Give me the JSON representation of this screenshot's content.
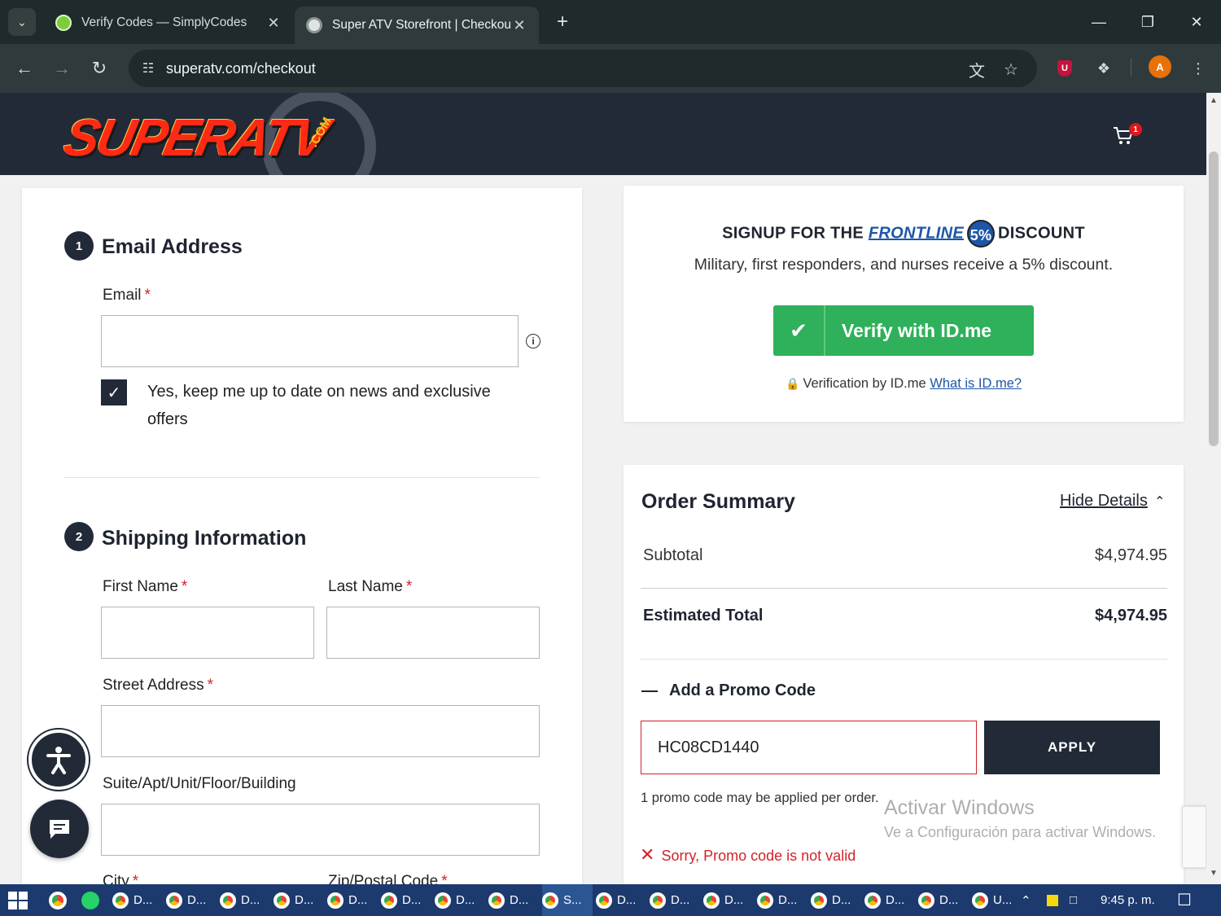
{
  "browser": {
    "tabs": [
      {
        "title": "Verify Codes — SimplyCodes"
      },
      {
        "title": "Super ATV Storefront | Checkout"
      }
    ],
    "new_tab": "+",
    "url": "superatv.com/checkout",
    "profile_initial": "A"
  },
  "header": {
    "logo_text": "SUPERATV",
    "logo_suffix": ".COM",
    "cart_count": "1"
  },
  "email_section": {
    "step": "1",
    "title": "Email Address",
    "email_label": "Email",
    "required_mark": "*",
    "email_value": "",
    "newsletter_label": "Yes, keep me up to date on news and exclusive offers",
    "newsletter_checked": true
  },
  "shipping_section": {
    "step": "2",
    "title": "Shipping Information",
    "first_name_label": "First Name",
    "last_name_label": "Last Name",
    "street_label": "Street Address",
    "suite_label": "Suite/Apt/Unit/Floor/Building",
    "city_label": "City",
    "zip_label": "Zip/Postal Code"
  },
  "frontline": {
    "title_pre": "SIGNUP FOR THE",
    "brand": "FRONTLINE",
    "five": "5%",
    "title_post": "DISCOUNT",
    "description": "Military, first responders, and nurses receive a 5% discount.",
    "button_label": "Verify with ID.me",
    "note": "Verification by ID.me",
    "link": "What is ID.me?"
  },
  "order_summary": {
    "title": "Order Summary",
    "hide_details": "Hide Details",
    "subtotal_label": "Subtotal",
    "subtotal_value": "$4,974.95",
    "total_label": "Estimated Total",
    "total_value": "$4,974.95",
    "promo_toggle": "Add a Promo Code",
    "promo_value": "HC08CD1440",
    "apply_label": "APPLY",
    "promo_note": "1 promo code may be applied per order.",
    "promo_error": "Sorry, Promo code is not valid"
  },
  "os_watermark": {
    "line1": "Activar Windows",
    "line2": "Ve a Configuración para activar Windows."
  },
  "taskbar": {
    "items": [
      "D...",
      "D...",
      "D...",
      "D...",
      "D...",
      "D...",
      "D...",
      "D...",
      "S...",
      "D...",
      "D...",
      "D...",
      "D...",
      "D...",
      "D...",
      "D...",
      "U..."
    ],
    "clock": "9:45 p. m."
  },
  "colors": {
    "brand_dark": "#222a38",
    "error_red": "#d3222a",
    "idme_green": "#2eb15a",
    "frontline_blue": "#1e56a8"
  }
}
